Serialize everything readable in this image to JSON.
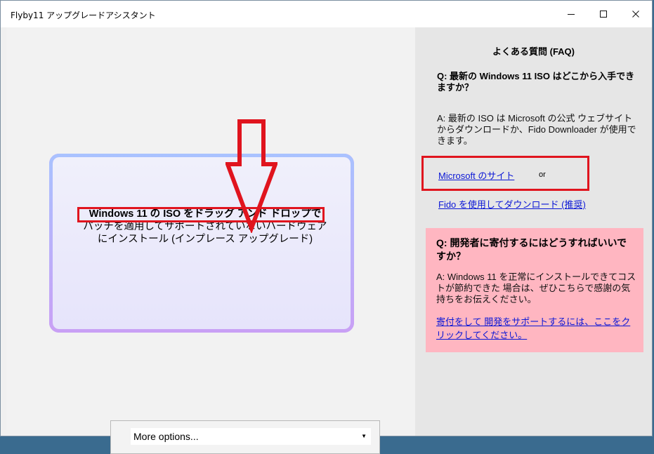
{
  "window": {
    "title": "Flyby11 アップグレードアシスタント",
    "minimize_glyph": "—",
    "maximize_glyph": "☐",
    "close_glyph": "✕"
  },
  "drop_zone": {
    "line1": "Windows 11 の ISO をドラッグ アンド ドロップで",
    "line2": "パッチを適用してサポートされていないハードウェア",
    "line3": "にインストール (インプレース アップグレード)"
  },
  "options": {
    "selected": "More options...",
    "arrow_glyph": "▼"
  },
  "faq": {
    "title": "よくある質問 (FAQ)",
    "q1": "Q: 最新の Windows 11 ISO はどこから入手できますか？",
    "a1": "A: 最新の ISO は Microsoft の公式 ウェブサイトからダウンロードか、Fido Downloader が使用できます。",
    "ms_link": "Microsoft のサイト",
    "or": "or",
    "fido_link": "Fido を使用してダウンロード (推奨)"
  },
  "donate": {
    "q": "Q:  開発者に寄付するにはどうすればいいですか？",
    "a": "A: Windows 11 を正常にインストールできてコストが節約できた 場合は、ぜひこちらで感謝の気持ちをお伝えください。",
    "link": "寄付をして 開発をサポートするには、ここをクリックしてください。"
  },
  "colors": {
    "highlight_red": "#e0141e",
    "link_blue": "#0b17d6",
    "donate_bg": "#ffb6c1"
  }
}
